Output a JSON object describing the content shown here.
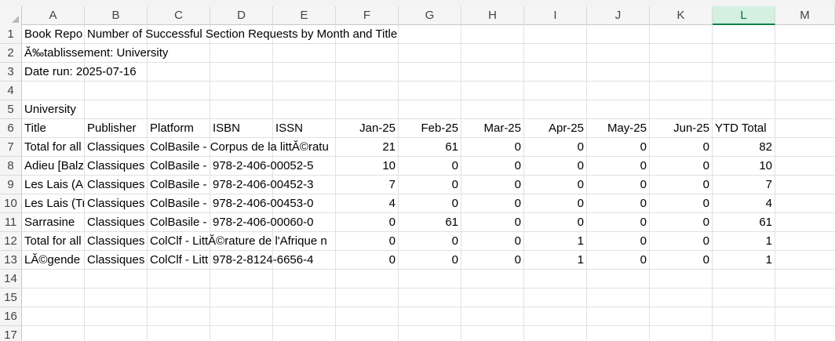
{
  "sheet": {
    "columns": [
      "A",
      "B",
      "C",
      "D",
      "E",
      "F",
      "G",
      "H",
      "I",
      "J",
      "K",
      "L",
      "M"
    ],
    "selected_column": "L",
    "rows": [
      "1",
      "2",
      "3",
      "4",
      "5",
      "6",
      "7",
      "8",
      "9",
      "10",
      "11",
      "12",
      "13",
      "14",
      "15",
      "16",
      "17"
    ],
    "title_a1": "Book Repo",
    "title_b1": "Number of Successful Section Requests by Month and Title",
    "institution_line": "Ă‰tablissement: University",
    "date_run": "Date run: 2025-07-16",
    "section_label": "University",
    "headers": {
      "title": "Title",
      "publisher": "Publisher",
      "platform": "Platform",
      "isbn": "ISBN",
      "issn": "ISSN",
      "months": [
        "Jan-25",
        "Feb-25",
        "Mar-25",
        "Apr-25",
        "May-25",
        "Jun-25"
      ],
      "ytd": "YTD Total"
    },
    "data_rows": [
      {
        "title": "Total for all",
        "publisher": "Classiques",
        "platform": "ColBasile - Corpus de la littĂ©ratu",
        "isbn": "",
        "values": [
          "21",
          "61",
          "0",
          "0",
          "0",
          "0"
        ],
        "ytd": "82"
      },
      {
        "title": "Adieu [Balza",
        "publisher": "Classiques",
        "platform": "ColBasile -",
        "isbn": "978-2-406-00052-5",
        "values": [
          "10",
          "0",
          "0",
          "0",
          "0",
          "0"
        ],
        "ytd": "10"
      },
      {
        "title": "Les Lais (Ar",
        "publisher": "Classiques",
        "platform": "ColBasile -",
        "isbn": "978-2-406-00452-3",
        "values": [
          "7",
          "0",
          "0",
          "0",
          "0",
          "0"
        ],
        "ytd": "7"
      },
      {
        "title": "Les Lais (Tr",
        "publisher": "Classiques",
        "platform": "ColBasile -",
        "isbn": "978-2-406-00453-0",
        "values": [
          "4",
          "0",
          "0",
          "0",
          "0",
          "0"
        ],
        "ytd": "4"
      },
      {
        "title": "Sarrasine",
        "publisher": "Classiques",
        "platform": "ColBasile -",
        "isbn": "978-2-406-00060-0",
        "values": [
          "0",
          "61",
          "0",
          "0",
          "0",
          "0"
        ],
        "ytd": "61"
      },
      {
        "title": "Total for all",
        "publisher": "Classiques",
        "platform": "ColClf - LittĂ©rature de l'Afrique n",
        "isbn": "",
        "values": [
          "0",
          "0",
          "0",
          "1",
          "0",
          "0"
        ],
        "ytd": "1"
      },
      {
        "title": "LĂ©gende",
        "publisher": "Classiques",
        "platform": "ColClf - Litt",
        "isbn": "978-2-8124-6656-4",
        "values": [
          "0",
          "0",
          "0",
          "1",
          "0",
          "0"
        ],
        "ytd": "1"
      }
    ]
  }
}
